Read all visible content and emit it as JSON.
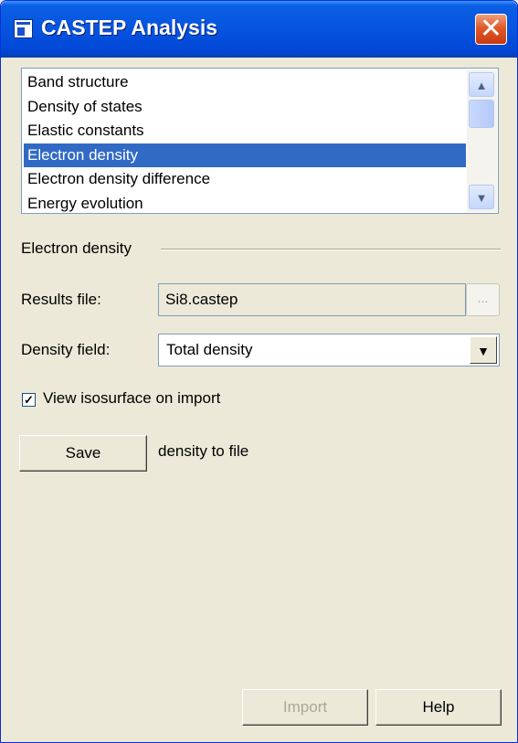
{
  "window": {
    "title": "CASTEP Analysis",
    "icons": {
      "app": "window-icon",
      "close": "close-x-icon"
    },
    "close_glyph": "✕"
  },
  "analysis_list": {
    "items": [
      "Band structure",
      "Density of states",
      "Elastic constants",
      "Electron density",
      "Electron density difference",
      "Energy evolution"
    ],
    "selected": "Electron density",
    "scrollbar": {
      "up_glyph": "▲",
      "down_glyph": "▼"
    }
  },
  "section": {
    "title": "Electron density",
    "results_file": {
      "label": "Results file:",
      "value": "Si8.castep",
      "browse_label": "..."
    },
    "density_field": {
      "label": "Density field:",
      "value": "Total density",
      "arrow_glyph": "▼"
    },
    "view_isosurface": {
      "label": "View isosurface on import",
      "checked": true,
      "check_glyph": "✓"
    },
    "save": {
      "button_label": "Save",
      "suffix": "density to file"
    }
  },
  "footer": {
    "import_label": "Import",
    "import_enabled": false,
    "help_label": "Help"
  },
  "colors": {
    "title_bar": "#0754df",
    "selection": "#316ac5",
    "dialog_bg": "#ece9d8",
    "close_button": "#e05a2a"
  }
}
